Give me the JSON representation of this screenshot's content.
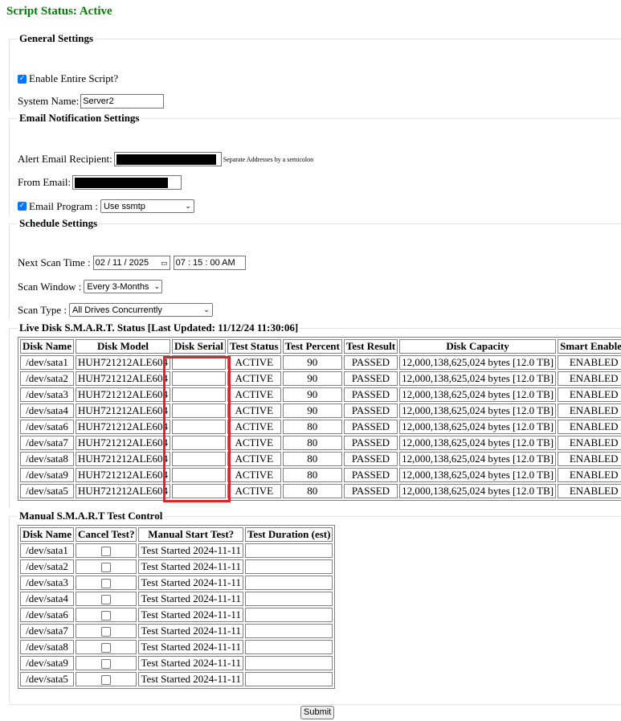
{
  "status": {
    "title": "Script Status: Active"
  },
  "general": {
    "legend": "General Settings",
    "enable_label": "Enable Entire Script?",
    "enable_checked": true,
    "system_name_label": "System Name:",
    "system_name_value": "Server2"
  },
  "email": {
    "legend": "Email Notification Settings",
    "alert_label": "Alert Email Recipient:",
    "alert_note": "Separate Addresses by a semicolon",
    "from_label": "From Email:",
    "program_label": "Email Program :",
    "program_checked": true,
    "program_value": "Use ssmtp"
  },
  "schedule": {
    "legend": "Schedule Settings",
    "next_scan_label": "Next Scan Time :",
    "date_value": "02 / 11 / 2025",
    "time_value": "07 : 15 : 00  AM",
    "scan_window_label": "Scan Window :",
    "scan_window_value": "Every 3-Months",
    "scan_type_label": "Scan Type :",
    "scan_type_value": "All Drives Concurrently"
  },
  "live": {
    "legend": "Live Disk S.M.A.R.T. Status [Last Updated: 11/12/24 11:30:06]",
    "headers": [
      "Disk Name",
      "Disk Model",
      "Disk Serial",
      "Test Status",
      "Test Percent",
      "Test Result",
      "Disk Capacity",
      "Smart Enabled"
    ],
    "rows": [
      {
        "name": "/dev/sata1",
        "model": "HUH721212ALE604",
        "serial": "",
        "status": "ACTIVE",
        "percent": "90",
        "result": "PASSED",
        "capacity": "12,000,138,625,024 bytes [12.0 TB]",
        "smart": "ENABLED"
      },
      {
        "name": "/dev/sata2",
        "model": "HUH721212ALE604",
        "serial": "",
        "status": "ACTIVE",
        "percent": "90",
        "result": "PASSED",
        "capacity": "12,000,138,625,024 bytes [12.0 TB]",
        "smart": "ENABLED"
      },
      {
        "name": "/dev/sata3",
        "model": "HUH721212ALE604",
        "serial": "",
        "status": "ACTIVE",
        "percent": "90",
        "result": "PASSED",
        "capacity": "12,000,138,625,024 bytes [12.0 TB]",
        "smart": "ENABLED"
      },
      {
        "name": "/dev/sata4",
        "model": "HUH721212ALE604",
        "serial": "",
        "status": "ACTIVE",
        "percent": "90",
        "result": "PASSED",
        "capacity": "12,000,138,625,024 bytes [12.0 TB]",
        "smart": "ENABLED"
      },
      {
        "name": "/dev/sata6",
        "model": "HUH721212ALE604",
        "serial": "",
        "status": "ACTIVE",
        "percent": "80",
        "result": "PASSED",
        "capacity": "12,000,138,625,024 bytes [12.0 TB]",
        "smart": "ENABLED"
      },
      {
        "name": "/dev/sata7",
        "model": "HUH721212ALE604",
        "serial": "",
        "status": "ACTIVE",
        "percent": "80",
        "result": "PASSED",
        "capacity": "12,000,138,625,024 bytes [12.0 TB]",
        "smart": "ENABLED"
      },
      {
        "name": "/dev/sata8",
        "model": "HUH721212ALE604",
        "serial": "",
        "status": "ACTIVE",
        "percent": "80",
        "result": "PASSED",
        "capacity": "12,000,138,625,024 bytes [12.0 TB]",
        "smart": "ENABLED"
      },
      {
        "name": "/dev/sata9",
        "model": "HUH721212ALE604",
        "serial": "",
        "status": "ACTIVE",
        "percent": "80",
        "result": "PASSED",
        "capacity": "12,000,138,625,024 bytes [12.0 TB]",
        "smart": "ENABLED"
      },
      {
        "name": "/dev/sata5",
        "model": "HUH721212ALE604",
        "serial": "",
        "status": "ACTIVE",
        "percent": "80",
        "result": "PASSED",
        "capacity": "12,000,138,625,024 bytes [12.0 TB]",
        "smart": "ENABLED"
      }
    ]
  },
  "manual": {
    "legend": "Manual S.M.A.R.T Test Control",
    "headers": [
      "Disk Name",
      "Cancel Test?",
      "Manual Start Test?",
      "Test Duration (est)"
    ],
    "rows": [
      {
        "name": "/dev/sata1",
        "start": "Test Started 2024-11-11",
        "duration": ""
      },
      {
        "name": "/dev/sata2",
        "start": "Test Started 2024-11-11",
        "duration": ""
      },
      {
        "name": "/dev/sata3",
        "start": "Test Started 2024-11-11",
        "duration": ""
      },
      {
        "name": "/dev/sata4",
        "start": "Test Started 2024-11-11",
        "duration": ""
      },
      {
        "name": "/dev/sata6",
        "start": "Test Started 2024-11-11",
        "duration": ""
      },
      {
        "name": "/dev/sata7",
        "start": "Test Started 2024-11-11",
        "duration": ""
      },
      {
        "name": "/dev/sata8",
        "start": "Test Started 2024-11-11",
        "duration": ""
      },
      {
        "name": "/dev/sata9",
        "start": "Test Started 2024-11-11",
        "duration": ""
      },
      {
        "name": "/dev/sata5",
        "start": "Test Started 2024-11-11",
        "duration": ""
      }
    ]
  },
  "submit": {
    "label": "Submit"
  },
  "colors": {
    "status_green": "#008000",
    "highlight_red": "#e4222b",
    "checkbox_blue": "#0075ff"
  }
}
